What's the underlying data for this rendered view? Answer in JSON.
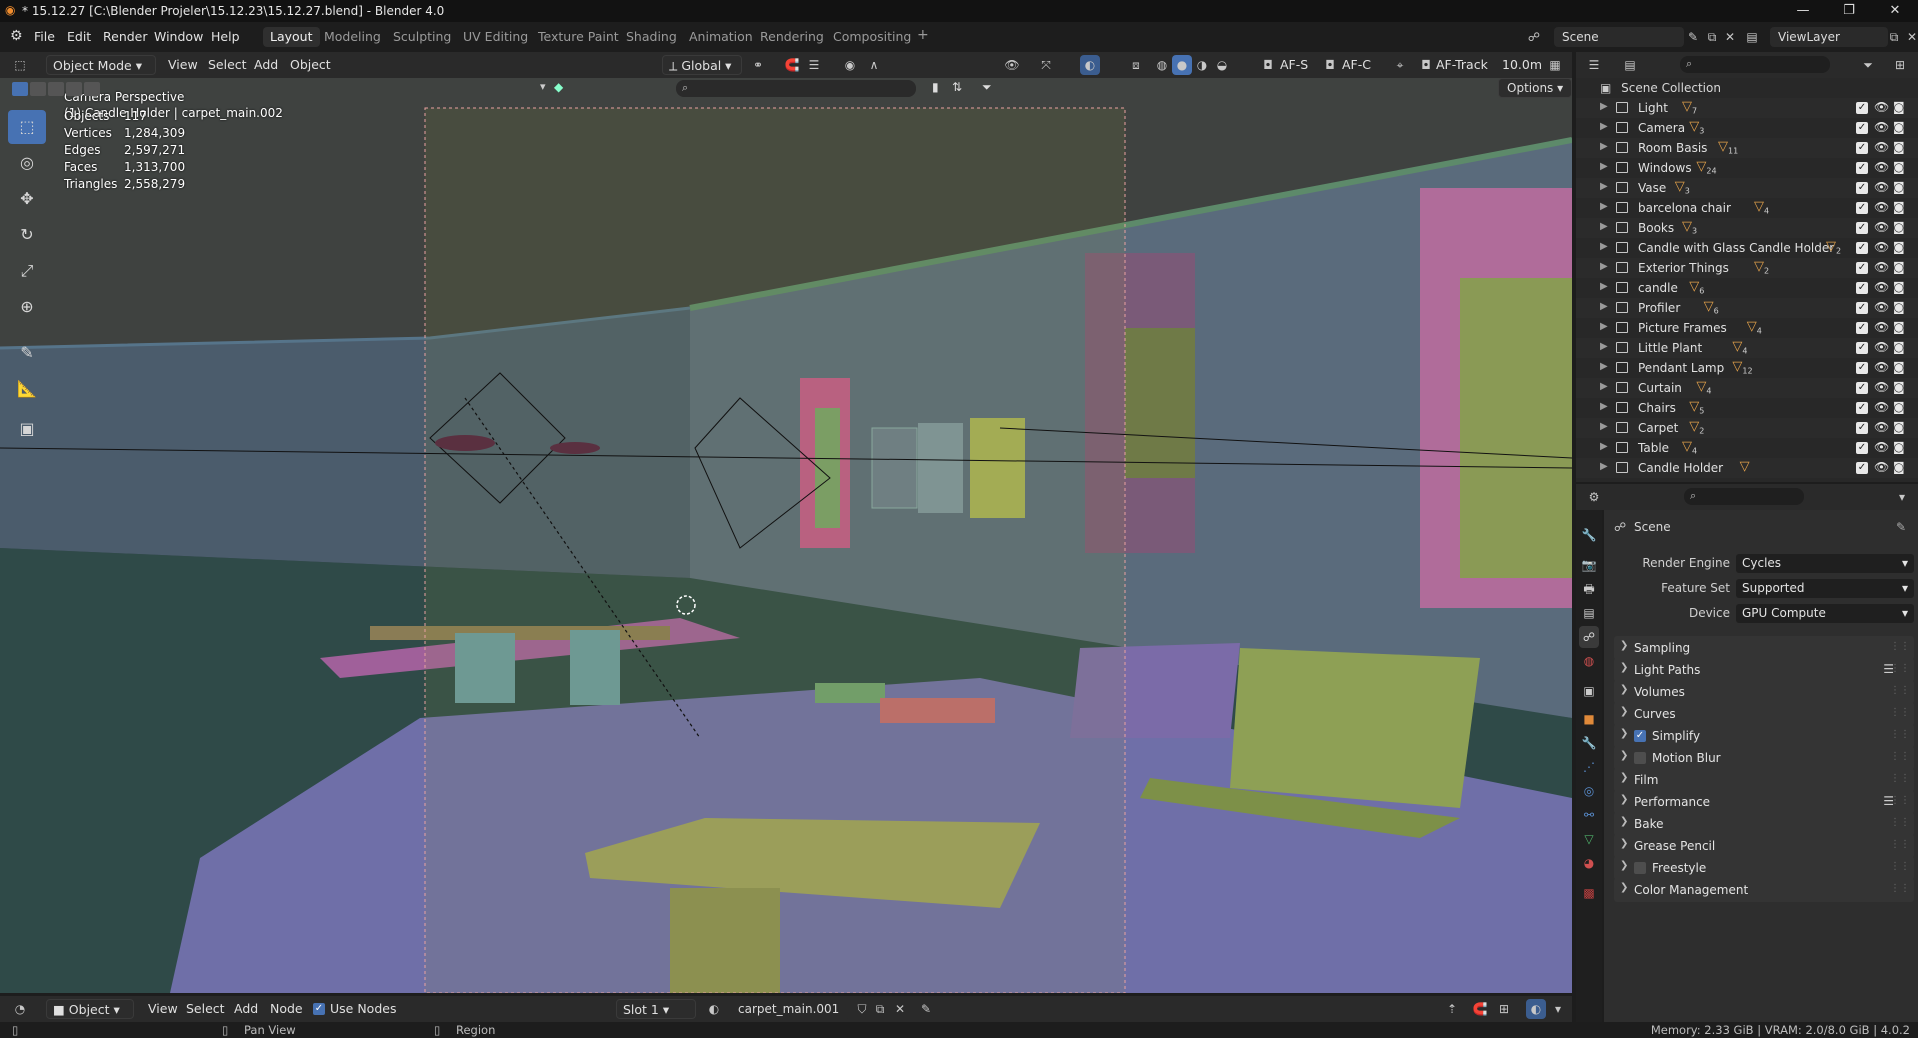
{
  "window": {
    "title": "* 15.12.27 [C:\\Blender Projeler\\15.12.23\\15.12.27.blend] - Blender 4.0",
    "minimize": "—",
    "maximize": "❐",
    "close": "✕"
  },
  "menubar": {
    "items": [
      "File",
      "Edit",
      "Render",
      "Window",
      "Help"
    ],
    "workspaces": [
      "Layout",
      "Modeling",
      "Sculpting",
      "UV Editing",
      "Texture Paint",
      "Shading",
      "Animation",
      "Rendering",
      "Compositing"
    ],
    "active_workspace": "Layout",
    "add_workspace": "+",
    "scene": "Scene",
    "view_layer": "ViewLayer"
  },
  "viewport_header": {
    "mode": "Object Mode",
    "menus": [
      "View",
      "Select",
      "Add",
      "Object"
    ],
    "transform_orientation": "Global",
    "af_s": "AF-S",
    "af_c": "AF-C",
    "af_track": "AF-Track",
    "focus_distance": "10.0m",
    "options": "Options"
  },
  "viewport": {
    "camera_label": "Camera Perspective",
    "object_label": "(1) Candle Holder | carpet_main.002",
    "stats": [
      {
        "label": "Objects",
        "value": "117"
      },
      {
        "label": "Vertices",
        "value": "1,284,309"
      },
      {
        "label": "Edges",
        "value": "2,597,271"
      },
      {
        "label": "Faces",
        "value": "1,313,700"
      },
      {
        "label": "Triangles",
        "value": "2,558,279"
      }
    ]
  },
  "shader_header": {
    "editor": "Object",
    "menus": [
      "View",
      "Select",
      "Add",
      "Node"
    ],
    "use_nodes": "Use Nodes",
    "slot": "Slot 1",
    "material": "carpet_main.001"
  },
  "statusbar": {
    "pan_view": "Pan View",
    "region": "Region",
    "memory": "Memory: 2.33 GiB | VRAM: 2.0/8.0 GiB | 4.0.2"
  },
  "outliner": {
    "root": "Scene Collection",
    "items": [
      {
        "name": "Light",
        "badge": "7"
      },
      {
        "name": "Camera",
        "badge": "3"
      },
      {
        "name": "Room Basis",
        "badge": "11"
      },
      {
        "name": "Windows",
        "badge": "24"
      },
      {
        "name": "Vase",
        "badge": "3"
      },
      {
        "name": "barcelona chair",
        "badge": "4"
      },
      {
        "name": "Books",
        "badge": "3"
      },
      {
        "name": "Candle with Glass Candle Holder",
        "badge": "2"
      },
      {
        "name": "Exterior Things",
        "badge": "2"
      },
      {
        "name": "candle",
        "badge": "6"
      },
      {
        "name": "Profiler",
        "badge": "6"
      },
      {
        "name": "Picture Frames",
        "badge": "4"
      },
      {
        "name": "Little Plant",
        "badge": "4"
      },
      {
        "name": "Pendant Lamp",
        "badge": "12"
      },
      {
        "name": "Curtain",
        "badge": "4"
      },
      {
        "name": "Chairs",
        "badge": "5"
      },
      {
        "name": "Carpet",
        "badge": "2"
      },
      {
        "name": "Table",
        "badge": "4"
      },
      {
        "name": "Candle Holder",
        "badge": ""
      }
    ]
  },
  "properties": {
    "context": "Scene",
    "fields": [
      {
        "label": "Render Engine",
        "value": "Cycles"
      },
      {
        "label": "Feature Set",
        "value": "Supported"
      },
      {
        "label": "Device",
        "value": "GPU Compute"
      }
    ],
    "panels": [
      {
        "name": "Sampling",
        "checkbox": false,
        "checked": false,
        "list": false
      },
      {
        "name": "Light Paths",
        "checkbox": false,
        "checked": false,
        "list": true
      },
      {
        "name": "Volumes",
        "checkbox": false,
        "checked": false,
        "list": false
      },
      {
        "name": "Curves",
        "checkbox": false,
        "checked": false,
        "list": false
      },
      {
        "name": "Simplify",
        "checkbox": true,
        "checked": true,
        "list": false
      },
      {
        "name": "Motion Blur",
        "checkbox": true,
        "checked": false,
        "list": false
      },
      {
        "name": "Film",
        "checkbox": false,
        "checked": false,
        "list": false
      },
      {
        "name": "Performance",
        "checkbox": false,
        "checked": false,
        "list": true
      },
      {
        "name": "Bake",
        "checkbox": false,
        "checked": false,
        "list": false
      },
      {
        "name": "Grease Pencil",
        "checkbox": false,
        "checked": false,
        "list": false
      },
      {
        "name": "Freestyle",
        "checkbox": true,
        "checked": false,
        "list": false
      },
      {
        "name": "Color Management",
        "checkbox": false,
        "checked": false,
        "list": false
      }
    ]
  },
  "colors": {
    "accent": "#4772b3",
    "collection_badge": "#e1a04a"
  }
}
